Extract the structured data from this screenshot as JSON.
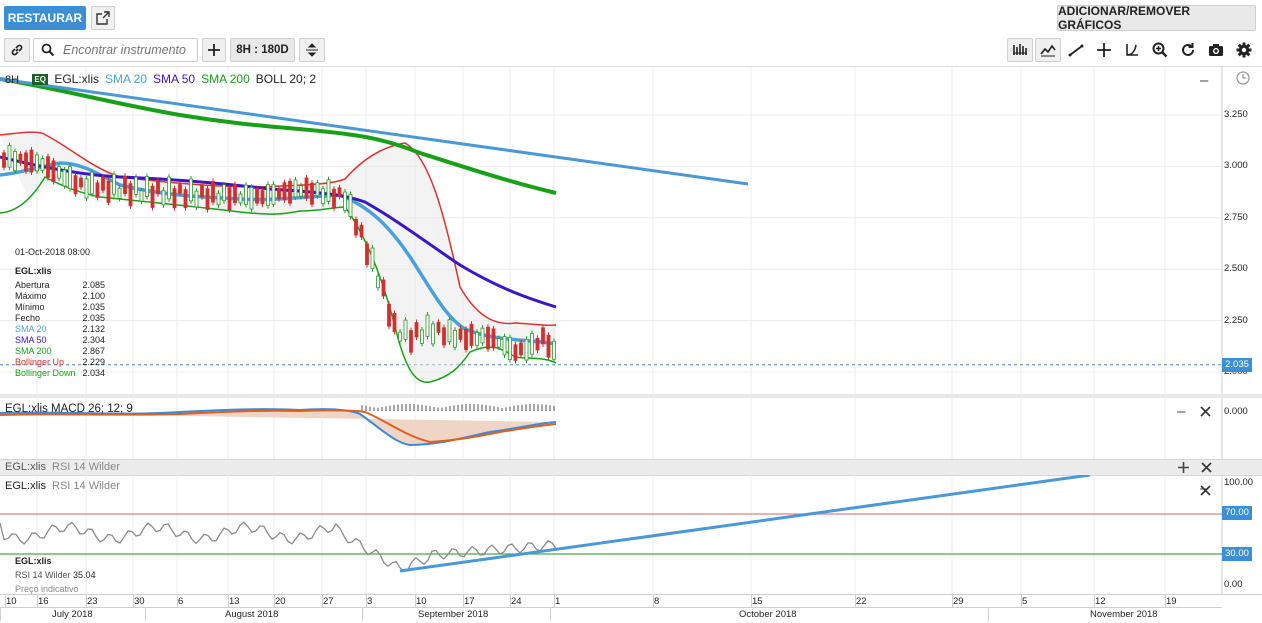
{
  "toolbar": {
    "restore_label": "RESTAURAR",
    "add_remove_label": "ADICIONAR/REMOVER GRÁFICOS",
    "search_placeholder": "Encontrar instrumento",
    "period_label": "8H : 180D"
  },
  "main_panel": {
    "period_short": "8H",
    "legend": [
      {
        "text": "EGL:xlis",
        "color": "#222222"
      },
      {
        "text": "SMA 20",
        "color": "#4aa0dc"
      },
      {
        "text": "SMA 50",
        "color": "#3a16c8"
      },
      {
        "text": "SMA 200",
        "color": "#18a018"
      },
      {
        "text": "BOLL 20; 2",
        "color": "#222222"
      }
    ],
    "price_axis": [
      "3.250",
      "3.000",
      "2.750",
      "2.500",
      "2.250",
      "2.000"
    ],
    "last_price": "2.035",
    "info_box": {
      "datetime": "01-Oct-2018 08:00",
      "symbol": "EGL:xlis",
      "rows": [
        {
          "label": "Abertura",
          "value": "2.085",
          "color": "#222222"
        },
        {
          "label": "Máximo",
          "value": "2.100",
          "color": "#222222"
        },
        {
          "label": "Mínimo",
          "value": "2.035",
          "color": "#222222"
        },
        {
          "label": "Fecho",
          "value": "2.035",
          "color": "#222222"
        },
        {
          "label": "SMA 20",
          "value": "2.132",
          "color": "#4aa0dc"
        },
        {
          "label": "SMA 50",
          "value": "2.304",
          "color": "#3a16c8"
        },
        {
          "label": "SMA 200",
          "value": "2.867",
          "color": "#18a018"
        },
        {
          "label": "Bollinger Up",
          "value": "2.229",
          "color": "#e03030"
        },
        {
          "label": "Bollinger Down",
          "value": "2.034",
          "color": "#18a018"
        }
      ]
    }
  },
  "macd_panel": {
    "title": "EGL:xlis  MACD 26; 12; 9",
    "axis": "0.000"
  },
  "rsi_collapsed": {
    "symbol": "EGL:xlis",
    "study": "RSI 14 Wilder"
  },
  "rsi_panel": {
    "symbol": "EGL:xlis",
    "study": "RSI 14 Wilder",
    "axis": [
      "100.00",
      "0.00"
    ],
    "upper_level": "70.00",
    "lower_level": "30.00",
    "info_symbol": "EGL:xlis",
    "info_label": "RSI 14 Wilder",
    "info_value": "35.04",
    "info_note": "Preço indicativo"
  },
  "time_axis": {
    "days": [
      "10",
      "16",
      "23",
      "30",
      "6",
      "13",
      "20",
      "27",
      "3",
      "10",
      "17",
      "24",
      "1",
      "8",
      "15",
      "22",
      "29",
      "5",
      "12",
      "19"
    ],
    "months": [
      "July 2018",
      "August 2018",
      "September 2018",
      "October 2018",
      "November 2018"
    ]
  },
  "colors": {
    "accent": "#3a8fd6",
    "sma20": "#4aa0dc",
    "sma50": "#3a16c8",
    "sma200": "#18a018",
    "boll_up": "#e03030",
    "boll_down": "#18a018",
    "trendline": "#4a98d8",
    "rsi_upper": "#e08080",
    "rsi_lower": "#40b040"
  }
}
